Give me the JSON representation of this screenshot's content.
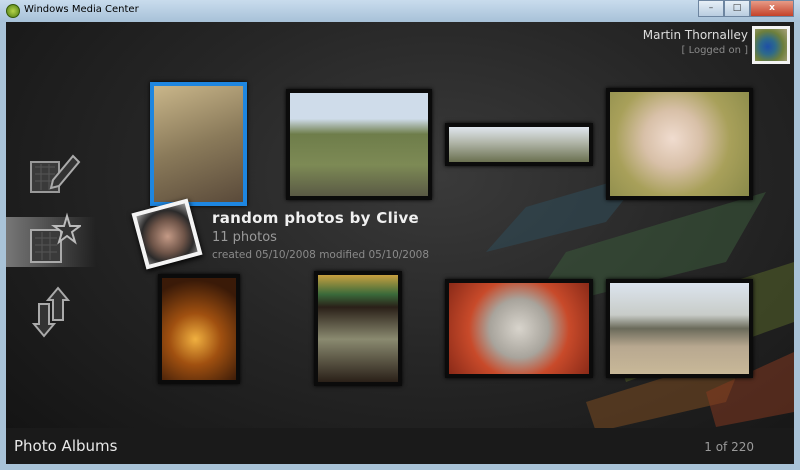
{
  "window": {
    "title": "Windows Media Center",
    "minimize": "–",
    "maximize": "□",
    "close": "x"
  },
  "user": {
    "name": "Martin Thornalley",
    "status": "[ Logged on ]"
  },
  "sidebar": [
    {
      "name": "edit-album"
    },
    {
      "name": "new-album"
    },
    {
      "name": "sort"
    }
  ],
  "album": {
    "title": "random photos  by  Clive",
    "count": "11 photos",
    "dates": "created 05/10/2008  modified 05/10/2008"
  },
  "footer": {
    "section": "Photo Albums",
    "pager": "1 of 220"
  },
  "colors": {
    "accent": "#1e86e0"
  }
}
